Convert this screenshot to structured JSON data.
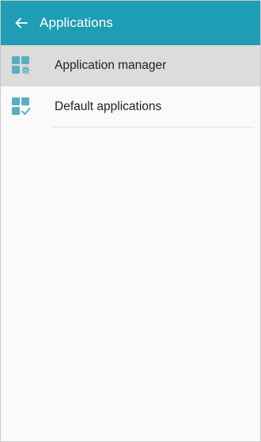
{
  "app_bar": {
    "title": "Applications",
    "back_icon": "arrow-left-icon"
  },
  "items": [
    {
      "label": "Application manager",
      "icon": "grid-gear-icon",
      "selected": true
    },
    {
      "label": "Default applications",
      "icon": "grid-check-icon",
      "selected": false
    }
  ],
  "colors": {
    "app_bar_bg": "#1e9db5",
    "selected_row_bg": "#dcdcdc",
    "icon_color": "#5aaec0",
    "background": "#fafafa"
  }
}
